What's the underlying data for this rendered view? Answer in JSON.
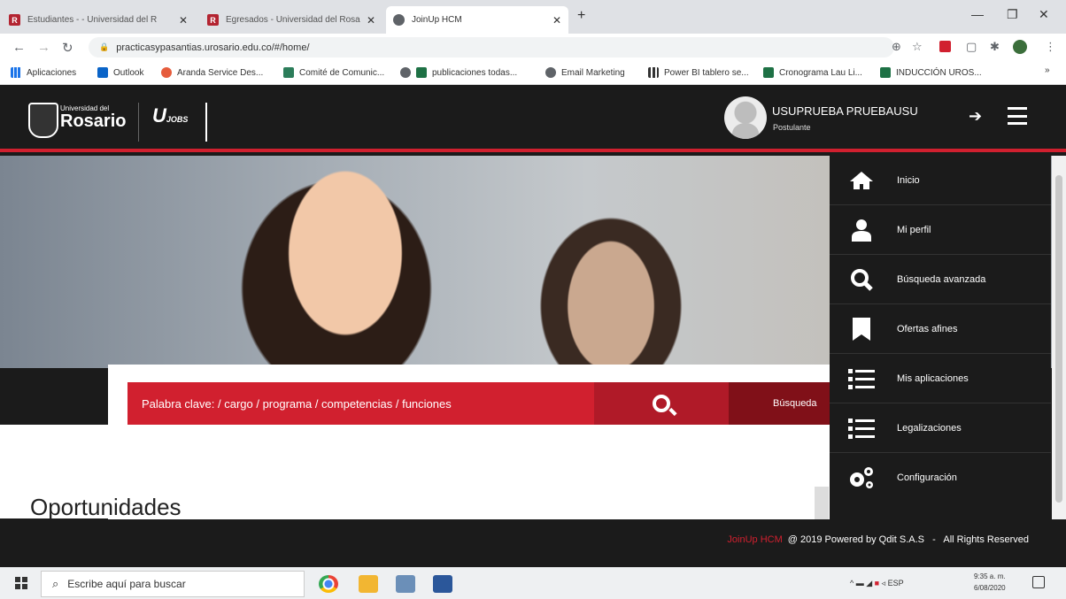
{
  "browser": {
    "tabs": [
      {
        "title": "Estudiantes - - Universidad del R",
        "icon": "rosario-favicon",
        "active": false
      },
      {
        "title": "Egresados - Universidad del Rosa",
        "icon": "rosario-favicon",
        "active": false
      },
      {
        "title": "JoinUp HCM",
        "icon": "globe-icon",
        "active": true
      }
    ],
    "url": "practicasypasantias.urosario.edu.co/#/home/",
    "bookmarks": [
      "Aplicaciones",
      "Outlook",
      "Aranda Service Des...",
      "Comité de Comunic...",
      "publicaciones todas...",
      "Email Marketing",
      "Power BI tablero se...",
      "Cronograma Lau Li...",
      "INDUCCIÓN UROS..."
    ]
  },
  "header": {
    "logo_small": "Universidad del",
    "logo_big": "Rosario",
    "jobs_logo": "JOBS",
    "user_name": "USUPRUEBA PRUEBAUSU",
    "user_role": "Postulante"
  },
  "search": {
    "placeholder": "Palabra clave: / cargo / programa / competencias / funciones",
    "advanced_label": "Búsqueda"
  },
  "main": {
    "section_title": "Oportunidades"
  },
  "menu": {
    "items": [
      {
        "label": "Inicio",
        "icon": "home-icon"
      },
      {
        "label": "Mi perfil",
        "icon": "user-icon"
      },
      {
        "label": "Búsqueda avanzada",
        "icon": "search-icon"
      },
      {
        "label": "Ofertas afines",
        "icon": "bookmark-icon"
      },
      {
        "label": "Mis aplicaciones",
        "icon": "list-icon"
      },
      {
        "label": "Legalizaciones",
        "icon": "list-icon"
      },
      {
        "label": "Configuración",
        "icon": "gears-icon"
      }
    ]
  },
  "footer": {
    "brand": "JoinUp HCM",
    "text": "@ 2019 Powered by Qdit S.A.S   -   All Rights Reserved"
  },
  "taskbar": {
    "search_placeholder": "Escribe aquí para buscar",
    "tray_lang": "ESP",
    "time": "9:35 a. m.",
    "date": "6/08/2020"
  },
  "colors": {
    "accent": "#d1202f",
    "header_bg": "#1b1b1b"
  }
}
